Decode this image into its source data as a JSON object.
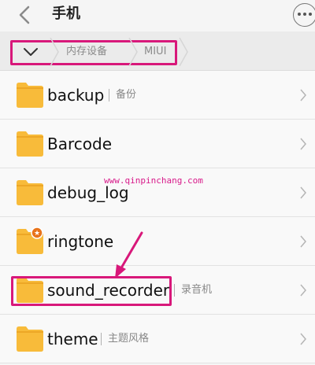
{
  "header": {
    "title": "手机",
    "back_icon": "chevron-left-icon",
    "more_icon": "more-dots-icon"
  },
  "breadcrumb": {
    "toggle_icon": "chevron-down-icon",
    "items": [
      "内存设备",
      "MIUI"
    ]
  },
  "files": [
    {
      "name": "backup",
      "note": "备份",
      "badge": false
    },
    {
      "name": "Barcode",
      "note": "",
      "badge": false
    },
    {
      "name": "debug_log",
      "note": "",
      "badge": false
    },
    {
      "name": "ringtone",
      "note": "",
      "badge": true
    },
    {
      "name": "sound_recorder",
      "note": "录音机",
      "badge": false
    },
    {
      "name": "theme",
      "note": "主题风格",
      "badge": false
    }
  ],
  "watermark": "www.qinpinchang.com",
  "colors": {
    "folder": "#f8bb3a",
    "folder_tab": "#eda726",
    "highlight": "#d8187a",
    "badge": "#e8731a"
  }
}
